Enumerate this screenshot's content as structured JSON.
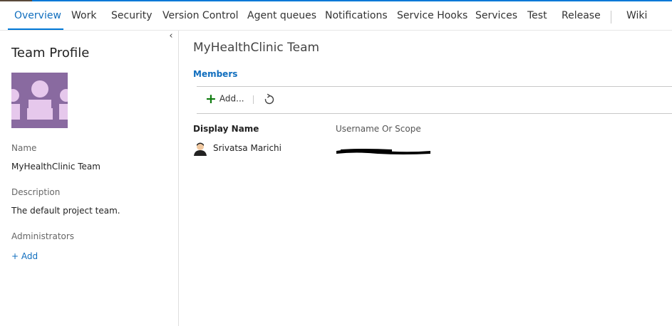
{
  "tabs": [
    {
      "label": "Overview",
      "active": true
    },
    {
      "label": "Work"
    },
    {
      "label": "Security"
    },
    {
      "label": "Version Control"
    },
    {
      "label": "Agent queues"
    },
    {
      "label": "Notifications"
    },
    {
      "label": "Service Hooks"
    },
    {
      "label": "Services"
    },
    {
      "label": "Test"
    },
    {
      "label": "Release"
    },
    {
      "label": "Wiki"
    }
  ],
  "sidebar": {
    "collapse_glyph": "‹",
    "title": "Team Profile",
    "name_label": "Name",
    "name_value": "MyHealthClinic Team",
    "description_label": "Description",
    "description_value": "The default project team.",
    "administrators_label": "Administrators",
    "add_admin_label": "+ Add"
  },
  "main": {
    "title": "MyHealthClinic Team",
    "members_heading": "Members",
    "toolbar": {
      "add_label": "Add...",
      "add_icon": "plus-icon",
      "refresh_icon": "refresh-icon"
    },
    "columns": {
      "display_name": "Display Name",
      "username": "Username Or Scope"
    },
    "members": [
      {
        "display_name": "Srivatsa Marichi",
        "username": "",
        "username_redacted": true
      }
    ]
  },
  "colors": {
    "accent": "#0078d7",
    "link": "#106ebe",
    "avatar_bg": "#896aa0",
    "avatar_fg": "#e6c8ec",
    "add_plus": "#107c10"
  }
}
